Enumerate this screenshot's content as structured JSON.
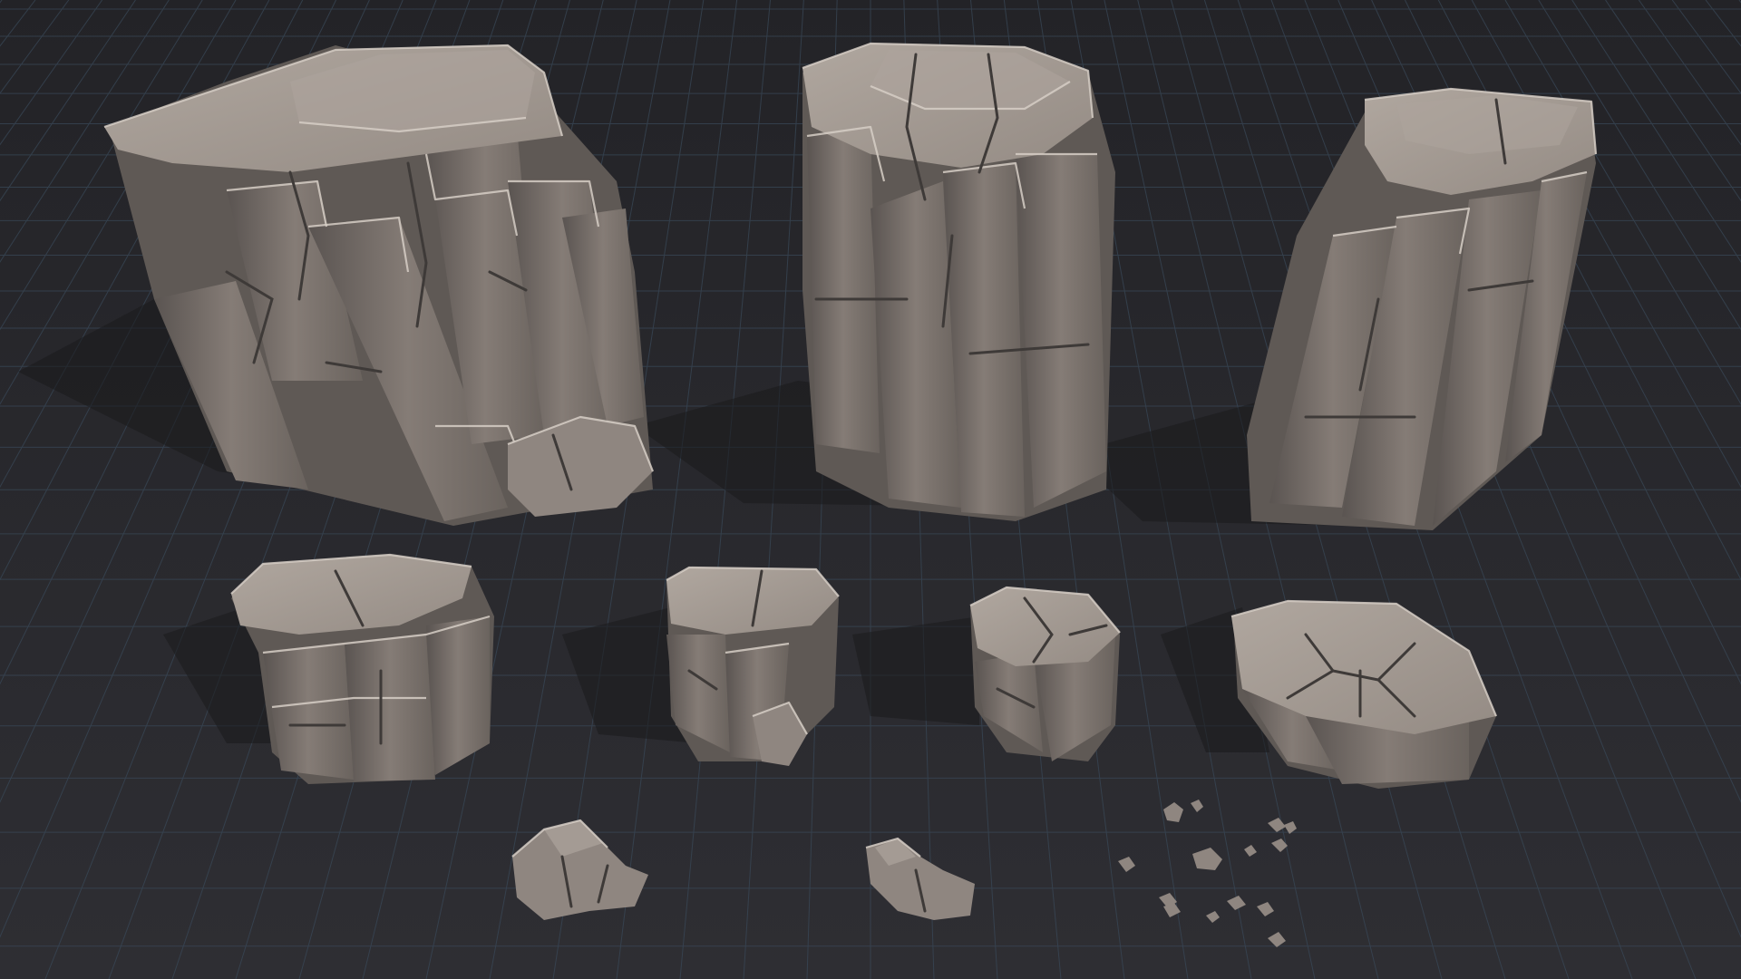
{
  "scene": {
    "background": "#2a2a2e",
    "grid_color": "#3a4a5a",
    "stone_color": "#8f8680",
    "stone_highlight": "#d6cec5",
    "assets": [
      {
        "name": "large-cliff-rock"
      },
      {
        "name": "tall-pillar-rock"
      },
      {
        "name": "leaning-pillar-rock"
      },
      {
        "name": "medium-rock-block"
      },
      {
        "name": "small-pillar-rock"
      },
      {
        "name": "small-cracked-rock"
      },
      {
        "name": "flat-slab-rock"
      },
      {
        "name": "pebble-cluster-a"
      },
      {
        "name": "pebble-cluster-b"
      },
      {
        "name": "scattered-pebbles"
      }
    ]
  }
}
